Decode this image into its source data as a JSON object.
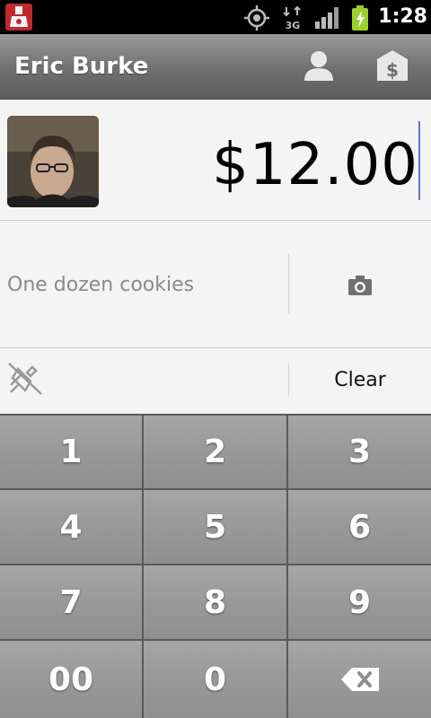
{
  "status_bar": {
    "time": "1:28",
    "network_label": "3G",
    "icons": [
      "app-notification-icon",
      "gps-icon",
      "3g-data-icon",
      "signal-strength-icon",
      "battery-charging-icon"
    ]
  },
  "action_bar": {
    "title": "Eric Burke",
    "actions": [
      "contact-icon",
      "money-icon"
    ]
  },
  "payment": {
    "amount": "$12.00",
    "memo_placeholder": "One dozen cookies",
    "clear_label": "Clear"
  },
  "keypad": {
    "keys": [
      "1",
      "2",
      "3",
      "4",
      "5",
      "6",
      "7",
      "8",
      "9",
      "00",
      "0"
    ],
    "backspace_icon": "backspace-icon"
  },
  "colors": {
    "status_bar": "#000000",
    "action_bar": "#767676",
    "content_bg": "#f4f4f4",
    "key_bg": "#9d9d9d",
    "cursor": "#6b6bd6"
  }
}
